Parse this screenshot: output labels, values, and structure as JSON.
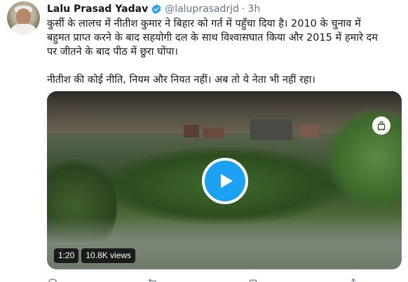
{
  "tweet": {
    "author_name": "Lalu Prasad Yadav",
    "handle": "@laluprasadrjd",
    "separator": "·",
    "time": "3h",
    "text_line1": "कुर्सी के लालच में नीतीश कुमार ने बिहार को गर्त में पहुँचा दिया है। 2010 के चुनाव में",
    "text_line2": "बहुमत प्राप्त करने के बाद सहयोगी दल के साथ विश्वासघात किया और 2015 में हमारे दम",
    "text_line3": "पर जीतने के बाद पीठ में छुरा घोंपा।",
    "text_line4": "नीतीश की कोई नीति, नियम और नियत नहीं। अब तो ये नेता भी नहीं रहा।"
  },
  "video": {
    "duration": "1:20",
    "views": "10.8K views"
  },
  "icons": {
    "verified": "verified-badge-icon",
    "play": "play-icon",
    "channel_logo": "channel-logo-icon",
    "reply": "reply-icon",
    "retweet": "retweet-icon",
    "like": "like-icon",
    "share": "share-icon"
  },
  "colors": {
    "accent": "#1da1f2",
    "muted": "#657786",
    "text": "#14171a"
  }
}
